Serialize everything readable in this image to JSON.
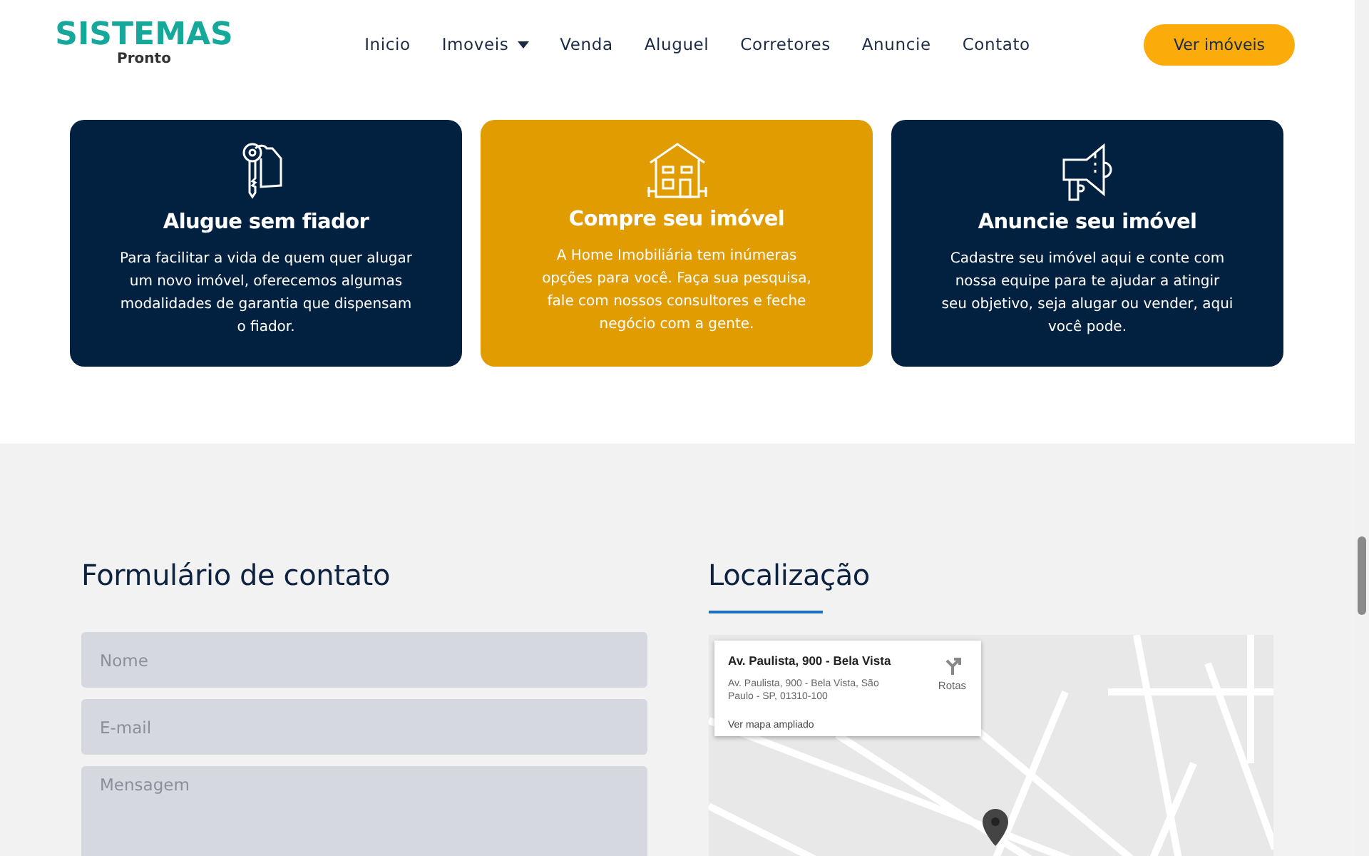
{
  "header": {
    "logo": {
      "title": "SISTEMAS",
      "subtitle": "Pronto"
    },
    "nav": [
      {
        "label": "Inicio",
        "has_dropdown": false
      },
      {
        "label": "Imoveis",
        "has_dropdown": true
      },
      {
        "label": "Venda",
        "has_dropdown": false
      },
      {
        "label": "Aluguel",
        "has_dropdown": false
      },
      {
        "label": "Corretores",
        "has_dropdown": false
      },
      {
        "label": "Anuncie",
        "has_dropdown": false
      },
      {
        "label": "Contato",
        "has_dropdown": false
      }
    ],
    "cta": "Ver imóveis"
  },
  "cards": [
    {
      "kind": "key",
      "color": "#022140",
      "title": "Alugue sem fiador",
      "text": "Para facilitar a vida de quem quer alugar um novo imóvel, oferecemos algumas modalidades de garantia que dispensam o fiador."
    },
    {
      "kind": "house",
      "color": "#e09c00",
      "title": "Compre seu imóvel",
      "text": "A Home Imobiliária tem inúmeras opções para você. Faça sua pesquisa, fale com nossos consultores e feche negócio com a gente."
    },
    {
      "kind": "megaphone",
      "color": "#022140",
      "title": "Anuncie seu imóvel",
      "text": "Cadastre seu imóvel aqui e conte com nossa equipe para te ajudar a atingir seu objetivo, seja alugar ou vender, aqui você pode."
    }
  ],
  "contact_form": {
    "title": "Formulário de contato",
    "fields": [
      {
        "kind": "input",
        "placeholder": "Nome"
      },
      {
        "kind": "input",
        "placeholder": "E-mail"
      },
      {
        "kind": "textarea",
        "placeholder": "Mensagem"
      }
    ]
  },
  "location": {
    "title": "Localização",
    "map_card": {
      "title": "Av. Paulista, 900 - Bela Vista",
      "address": "Av. Paulista, 900 - Bela Vista, São Paulo - SP, 01310-100",
      "directions": "Rotas",
      "link": "Ver mapa ampliado"
    }
  }
}
